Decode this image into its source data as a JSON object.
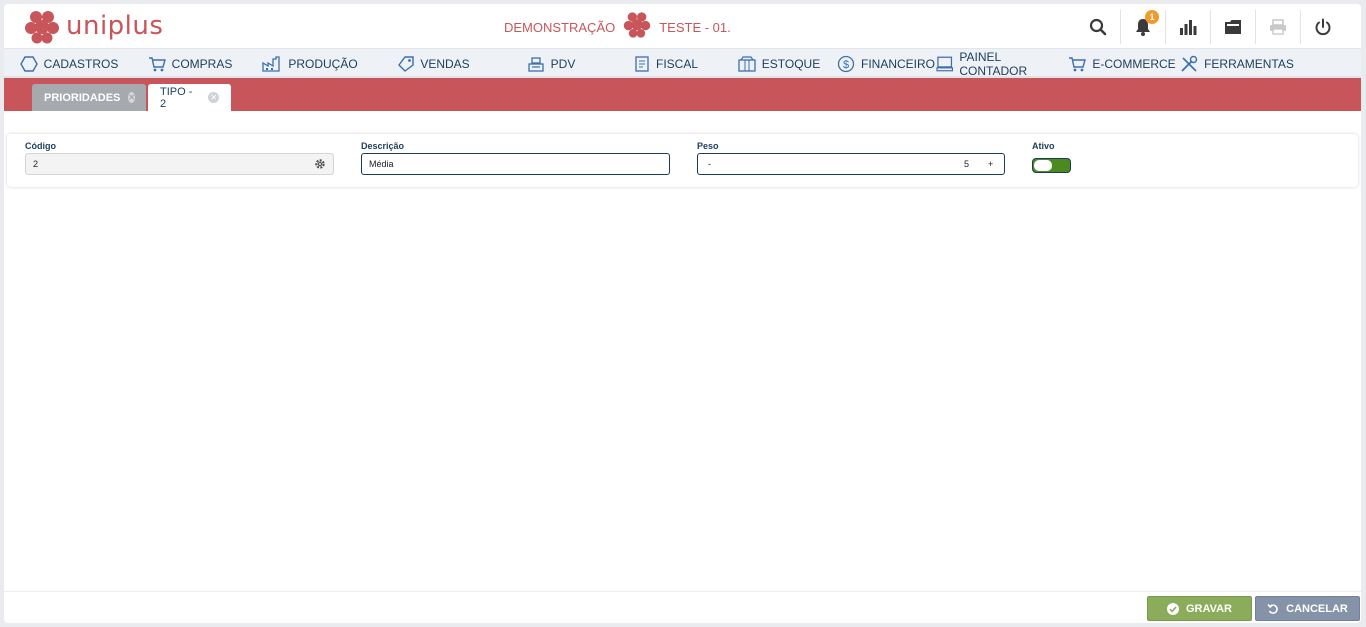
{
  "brand": {
    "name": "uniplus"
  },
  "company": {
    "left": "DEMONSTRAÇÃO",
    "right": "TESTE - 01."
  },
  "header_icons": {
    "notifications_count": "1"
  },
  "nav": {
    "items": [
      {
        "label": "CADASTROS",
        "icon": "hexagon-icon"
      },
      {
        "label": "COMPRAS",
        "icon": "cart-icon"
      },
      {
        "label": "PRODUÇÃO",
        "icon": "factory-icon"
      },
      {
        "label": "VENDAS",
        "icon": "tag-icon"
      },
      {
        "label": "PDV",
        "icon": "register-icon"
      },
      {
        "label": "FISCAL",
        "icon": "document-icon"
      },
      {
        "label": "ESTOQUE",
        "icon": "box-icon"
      },
      {
        "label": "FINANCEIRO",
        "icon": "dollar-icon"
      },
      {
        "label": "PAINEL CONTADOR",
        "icon": "monitor-icon"
      },
      {
        "label": "E-COMMERCE",
        "icon": "cart-icon"
      },
      {
        "label": "FERRAMENTAS",
        "icon": "tools-icon"
      }
    ],
    "active": "VENDAS"
  },
  "tabs": [
    {
      "label": "PRIORIDADES"
    },
    {
      "label": "TIPO - 2"
    }
  ],
  "form": {
    "codigo": {
      "label": "Código",
      "value": "2"
    },
    "descricao": {
      "label": "Descrição",
      "value": "Média"
    },
    "peso": {
      "label": "Peso",
      "minus": "-",
      "value": "5",
      "plus": "+"
    },
    "ativo": {
      "label": "Ativo",
      "checked": true
    }
  },
  "footer": {
    "save_label": "GRAVAR",
    "cancel_label": "CANCELAR"
  },
  "colors": {
    "brand": "#c8555a",
    "nav_text": "#1d3c5c",
    "save": "#8bac5a",
    "cancel": "#8493a8",
    "badge": "#f19a2a"
  }
}
